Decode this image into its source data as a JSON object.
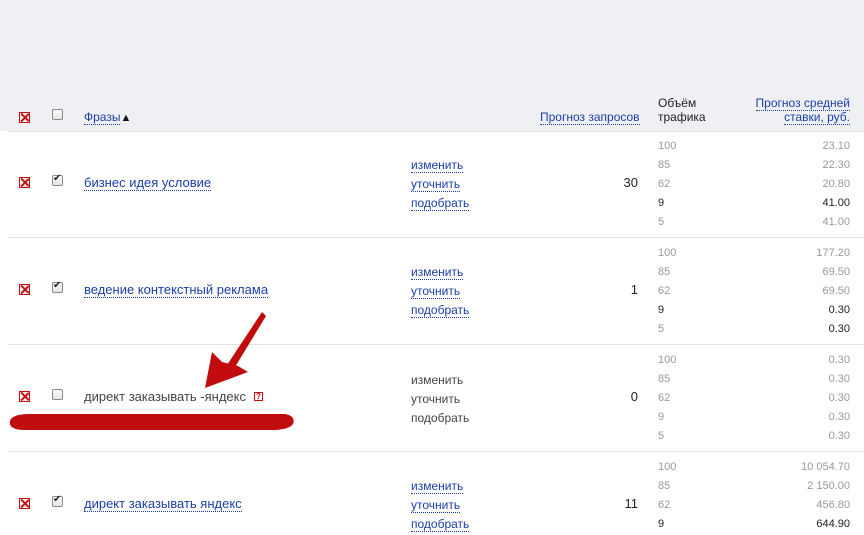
{
  "header": {
    "phrases_label": "Фразы",
    "sort_arrow": "▲",
    "forecast_label": "Прогноз запросов",
    "traffic_label_line1": "Объём",
    "traffic_label_line2": "трафика",
    "price_label_line1": "Прогноз средней",
    "price_label_line2": "ставки, руб."
  },
  "rows": [
    {
      "phrase": "бизнес идея условие",
      "checked": true,
      "active": true,
      "actions": [
        "изменить",
        "уточнить",
        "подобрать"
      ],
      "forecast": "30",
      "traffic": [
        "100",
        "85",
        "62",
        "9",
        "5"
      ],
      "prices": [
        "23.10",
        "22.30",
        "20.80",
        "41.00",
        "41.00"
      ]
    },
    {
      "phrase": "ведение контекстный реклама",
      "checked": true,
      "active": true,
      "actions": [
        "изменить",
        "уточнить",
        "подобрать"
      ],
      "forecast": "1",
      "traffic": [
        "100",
        "85",
        "62",
        "9",
        "5"
      ],
      "prices": [
        "177.20",
        "69.50",
        "69.50",
        "0.30",
        "0.30"
      ]
    },
    {
      "phrase": "директ заказывать -яндекс",
      "checked": false,
      "active": false,
      "help_icon": "question-icon",
      "actions": [
        "изменить",
        "уточнить",
        "подобрать"
      ],
      "forecast": "0",
      "traffic": [
        "100",
        "85",
        "62",
        "9",
        "5"
      ],
      "prices": [
        "0.30",
        "0.30",
        "0.30",
        "0.30",
        "0.30"
      ]
    },
    {
      "phrase": "директ заказывать яндекс",
      "checked": true,
      "active": true,
      "actions": [
        "изменить",
        "уточнить",
        "подобрать"
      ],
      "forecast": "11",
      "traffic": [
        "100",
        "85",
        "62",
        "9"
      ],
      "prices": [
        "10 054.70",
        "2 150.00",
        "456.80",
        "644.90"
      ]
    }
  ],
  "annotation": {
    "color": "#c00c0c",
    "shape": "arrow-and-underline"
  },
  "colors": {
    "link": "#1a3fa8",
    "header_bg": "#eef0f4",
    "delete_red": "#c80f0f"
  }
}
